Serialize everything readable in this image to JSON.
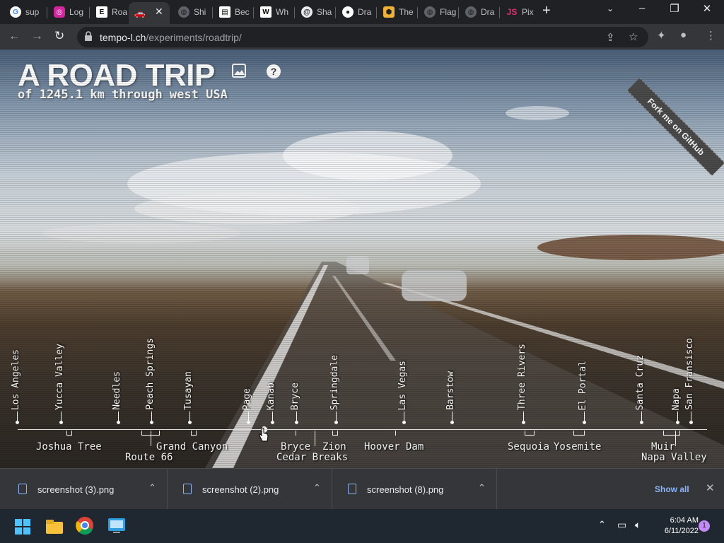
{
  "browser": {
    "tabs": [
      {
        "label": "sup",
        "icon": "google-icon",
        "color": "#4285f4"
      },
      {
        "label": "Log",
        "icon": "instagram-icon",
        "color": "#d6249f"
      },
      {
        "label": "Roa",
        "icon": "e-icon",
        "color": "#ffffff"
      },
      {
        "label": "",
        "icon": "car-icon",
        "color": "#e8eaed"
      },
      {
        "label": "Shi",
        "icon": "globe-icon",
        "color": "#9aa0a6"
      },
      {
        "label": "Bec",
        "icon": "doc-icon",
        "color": "#ffffff"
      },
      {
        "label": "Wh",
        "icon": "w-icon",
        "color": "#ffffff"
      },
      {
        "label": "Sha",
        "icon": "swirl-icon",
        "color": "#e8eaed"
      },
      {
        "label": "Dra",
        "icon": "github-icon",
        "color": "#ffffff"
      },
      {
        "label": "The",
        "icon": "hex-icon",
        "color": "#f2b134"
      },
      {
        "label": "Flag",
        "icon": "globe-icon",
        "color": "#9aa0a6"
      },
      {
        "label": "Dra",
        "icon": "globe-icon",
        "color": "#9aa0a6"
      },
      {
        "label": "Pix",
        "icon": "js-icon",
        "color": "#e0316b"
      }
    ],
    "url_host": "tempo-l.ch",
    "url_path": "/experiments/roadtrip/"
  },
  "page": {
    "title": "A ROAD TRIP",
    "subtitle": "of 1245.1 km through west USA",
    "help": "?",
    "ribbon": "Fork me on GitHub",
    "cities": [
      "Los Angeles",
      "Yucca Valley",
      "Needles",
      "Peach Springs",
      "Tusayan",
      "Page",
      "Kanab",
      "Bryce",
      "Springdale",
      "Las Vegas",
      "Barstow",
      "Three Rivers",
      "El Portal",
      "Santa Cruz",
      "Napa",
      "San Fransisco"
    ],
    "regions": {
      "joshua_tree": "Joshua Tree",
      "route_66": "Route 66",
      "grand_canyon": "Grand Canyon",
      "bryce": "Bryce",
      "zion": "Zion",
      "cedar_breaks": "Cedar Breaks",
      "hoover_dam": "Hoover Dam",
      "sequoia": "Sequoia",
      "yosemite": "Yosemite",
      "muir": "Muir",
      "napa_valley": "Napa Valley"
    }
  },
  "downloads": {
    "files": [
      "screenshot (3).png",
      "screenshot (2).png",
      "screenshot (8).png"
    ],
    "show_all": "Show all"
  },
  "taskbar": {
    "time": "6:04 AM",
    "date": "6/11/2022",
    "notifications": "1"
  }
}
